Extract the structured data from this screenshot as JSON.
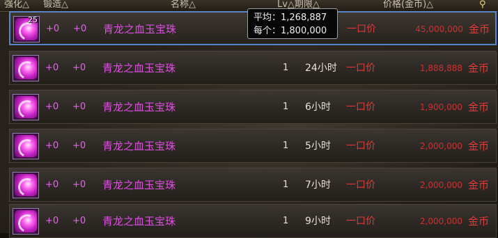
{
  "header": {
    "col_enhance": "强化△",
    "col_forge": "锻造△",
    "col_name": "名称△",
    "col_lv_duration": "Lv△期限△",
    "col_price": "价格(金币)△",
    "pin_icon": "pin-icon"
  },
  "tooltip": {
    "avg_label": "平均：1,268,887",
    "each_label": "每个：1,800,000"
  },
  "colors": {
    "item_name": "#e24de6",
    "price": "#d03030",
    "selected_border": "#5a85c8"
  },
  "rows": [
    {
      "stack": "25",
      "enhance": "+0",
      "forge": "+0",
      "name": "青龙之血玉宝珠",
      "lv": "",
      "time": "",
      "type": "一口价",
      "price": "45,000,000",
      "unit": "金币",
      "icon": "purple-orb-icon"
    },
    {
      "stack": "",
      "enhance": "+0",
      "forge": "+0",
      "name": "青龙之血玉宝珠",
      "lv": "1",
      "time": "24小时",
      "type": "一口价",
      "price": "1,888,888",
      "unit": "金币",
      "icon": "purple-orb-icon"
    },
    {
      "stack": "",
      "enhance": "+0",
      "forge": "+0",
      "name": "青龙之血玉宝珠",
      "lv": "1",
      "time": "6小时",
      "type": "一口价",
      "price": "1,900,000",
      "unit": "金币",
      "icon": "purple-orb-icon"
    },
    {
      "stack": "",
      "enhance": "+0",
      "forge": "+0",
      "name": "青龙之血玉宝珠",
      "lv": "1",
      "time": "5小时",
      "type": "一口价",
      "price": "2,000,000",
      "unit": "金币",
      "icon": "purple-orb-icon"
    },
    {
      "stack": "",
      "enhance": "+0",
      "forge": "+0",
      "name": "青龙之血玉宝珠",
      "lv": "1",
      "time": "7小时",
      "type": "一口价",
      "price": "2,000,000",
      "unit": "金币",
      "icon": "purple-orb-icon"
    },
    {
      "stack": "",
      "enhance": "+0",
      "forge": "+0",
      "name": "青龙之血玉宝珠",
      "lv": "1",
      "time": "9小时",
      "type": "一口价",
      "price": "2,000,000",
      "unit": "金币",
      "icon": "purple-orb-icon"
    }
  ]
}
